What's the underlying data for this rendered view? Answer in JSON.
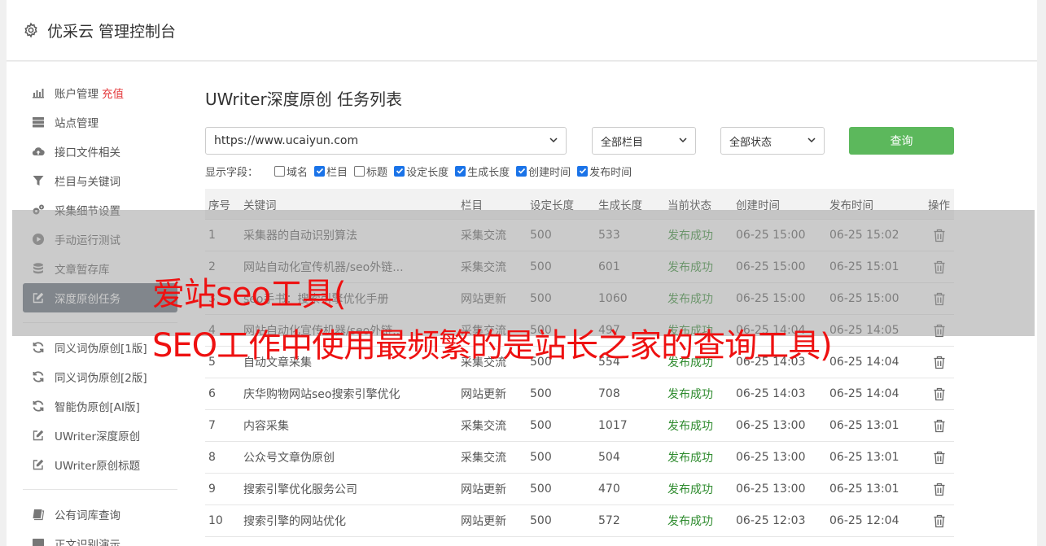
{
  "header": {
    "title": "优采云 管理控制台"
  },
  "sidebar": {
    "items": [
      {
        "label": "账户管理",
        "accent": "充值",
        "icon": "bar-chart-icon"
      },
      {
        "label": "站点管理",
        "icon": "server-icon"
      },
      {
        "label": "接口文件相关",
        "icon": "cloud-upload-icon"
      },
      {
        "label": "栏目与关键词",
        "icon": "filter-icon"
      },
      {
        "label": "采集细节设置",
        "icon": "cogs-icon"
      },
      {
        "label": "手动运行测试",
        "icon": "play-icon"
      },
      {
        "label": "文章暂存库",
        "icon": "database-icon"
      },
      {
        "label": "深度原创任务",
        "icon": "edit-icon",
        "active": true
      }
    ],
    "items2": [
      {
        "label": "同义词伪原创[1版]",
        "icon": "refresh-icon"
      },
      {
        "label": "同义词伪原创[2版]",
        "icon": "refresh-icon"
      },
      {
        "label": "智能伪原创[AI版]",
        "icon": "refresh-icon"
      },
      {
        "label": "UWriter深度原创",
        "icon": "edit-icon"
      },
      {
        "label": "UWriter原创标题",
        "icon": "edit-icon"
      }
    ],
    "items3": [
      {
        "label": "公有词库查询",
        "icon": "book-icon"
      },
      {
        "label": "正文识别演示",
        "icon": "monitor-icon"
      }
    ]
  },
  "main": {
    "title": "UWriter深度原创 任务列表",
    "filters": {
      "site": "https://www.ucaiyun.com",
      "column": "全部栏目",
      "status": "全部状态",
      "query_label": "查询"
    },
    "fields_label": "显示字段：",
    "fields": [
      {
        "label": "域名",
        "checked": false
      },
      {
        "label": "栏目",
        "checked": true
      },
      {
        "label": "标题",
        "checked": false
      },
      {
        "label": "设定长度",
        "checked": true
      },
      {
        "label": "生成长度",
        "checked": true
      },
      {
        "label": "创建时间",
        "checked": true
      },
      {
        "label": "发布时间",
        "checked": true
      }
    ],
    "table": {
      "headers": [
        "序号",
        "关键词",
        "栏目",
        "设定长度",
        "生成长度",
        "当前状态",
        "创建时间",
        "发布时间",
        "操作"
      ],
      "rows": [
        [
          "1",
          "采集器的自动识别算法",
          "采集交流",
          "500",
          "533",
          "发布成功",
          "06-25 15:00",
          "06-25 15:02"
        ],
        [
          "2",
          "网站自动化宣传机器/seo外链...",
          "采集交流",
          "500",
          "601",
          "发布成功",
          "06-25 15:00",
          "06-25 15:01"
        ],
        [
          "3",
          "seo手书：搜索引擎优化手册",
          "网站更新",
          "500",
          "1060",
          "发布成功",
          "06-25 15:00",
          "06-25 15:00"
        ],
        [
          "4",
          "网站自动化宣传机器/seo外链...",
          "采集交流",
          "500",
          "497",
          "发布成功",
          "06-25 14:04",
          "06-25 14:05"
        ],
        [
          "5",
          "自动文章采集",
          "采集交流",
          "500",
          "554",
          "发布成功",
          "06-25 14:03",
          "06-25 14:04"
        ],
        [
          "6",
          "庆华购物网站seo搜索引擎优化",
          "网站更新",
          "500",
          "708",
          "发布成功",
          "06-25 14:03",
          "06-25 14:04"
        ],
        [
          "7",
          "内容采集",
          "采集交流",
          "500",
          "1017",
          "发布成功",
          "06-25 13:00",
          "06-25 13:01"
        ],
        [
          "8",
          "公众号文章伪原创",
          "采集交流",
          "500",
          "504",
          "发布成功",
          "06-25 13:00",
          "06-25 13:01"
        ],
        [
          "9",
          "搜索引擎优化服务公司",
          "网站更新",
          "500",
          "470",
          "发布成功",
          "06-25 13:00",
          "06-25 13:01"
        ],
        [
          "10",
          "搜索引擎的网站优化",
          "网站更新",
          "500",
          "572",
          "发布成功",
          "06-25 12:03",
          "06-25 12:04"
        ]
      ]
    }
  },
  "watermark": {
    "line1": "爱站seo工具(",
    "line2": "SEO工作中使用最频繁的是站长之家的查询工具)"
  },
  "colors": {
    "accent_green": "#5cb85c",
    "status_green": "#2e8b2e",
    "watermark_red": "#ee1111",
    "active_item": "#5b6773"
  }
}
